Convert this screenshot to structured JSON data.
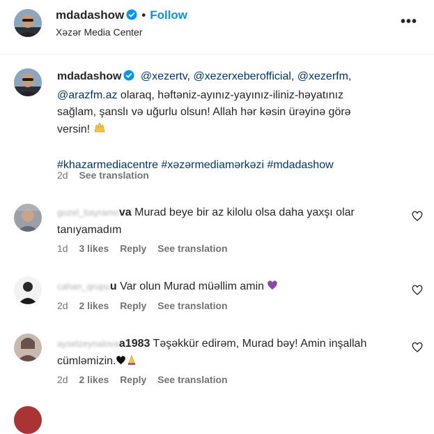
{
  "header": {
    "username": "mdadashow",
    "follow_label": "Follow",
    "dot": "•",
    "subtitle": "Xəzər Media Center",
    "more_label": "•••"
  },
  "caption": {
    "username": "mdadashow",
    "mentions": [
      "@xezertv",
      "@xezerxeberofficial",
      "@xezerfm",
      "@arazfm.az"
    ],
    "sep": ", ",
    "text": " olaraq, həftəniz-ayınız-yayınız-iliniz-həyatınız sağlam, şanslı və uğurlu olsun! Allah hər kəsin ürəyinə görə versin! ",
    "hashtags": [
      "#khazarmediacentre",
      "#xəzərmediamərkəzi",
      "#mdadashow"
    ],
    "time": "2d",
    "see_translation": "See translation"
  },
  "comments": [
    {
      "username_blurred": "gozel_bayramo",
      "username_visible_suffix": "va",
      "text": " Murad beye bir az kilolu olsa daha yaxşı olar tanıyamadım",
      "time": "1d",
      "likes": "3 likes",
      "reply": "Reply",
      "see_translation": "See translation"
    },
    {
      "username_blurred": "cahan_qrupu",
      "username_visible_suffix": "u",
      "text": " Var olun Murad müəllim amin ",
      "time": "2d",
      "likes": "2 likes",
      "reply": "Reply",
      "see_translation": "See translation"
    },
    {
      "username_blurred": "ayselzeynalova",
      "username_visible_suffix": "a1983",
      "text": " Təşəkkür edirəm, Murad bəy! Amin inşallah cümləmizin.",
      "time": "2d",
      "likes": "2 likes",
      "reply": "Reply",
      "see_translation": "See translation"
    }
  ],
  "icons": {
    "verified": "verified-badge-icon",
    "heart": "heart-outline-icon",
    "more": "more-options-icon"
  },
  "colors": {
    "accent": "#0095f6",
    "link": "#00376b",
    "secondary": "#737373",
    "verified": "#0095f6"
  }
}
